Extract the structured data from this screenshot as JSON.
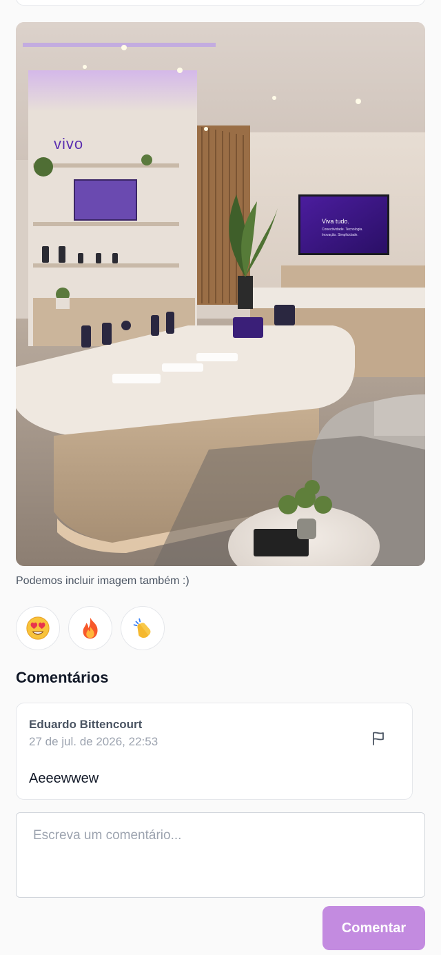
{
  "post": {
    "image_alt": "",
    "brand_logo_text": "vivo",
    "tv_screen": {
      "headline": "Viva tudo.",
      "subline_1": "Conectividade. Tecnologia.",
      "subline_2": "Inovação. Simplicidade."
    },
    "caption": "Podemos incluir imagem também :)"
  },
  "reactions": [
    {
      "icon": "heart-eyes-emoji-icon"
    },
    {
      "icon": "fire-emoji-icon"
    },
    {
      "icon": "clapping-hands-emoji-icon"
    }
  ],
  "comments": {
    "title": "Comentários",
    "items": [
      {
        "author": "Eduardo Bittencourt",
        "date": "27 de jul. de 2026, 22:53",
        "text": "Aeeewwew",
        "action_icon": "flag-icon"
      }
    ],
    "input_placeholder": "Escreva um comentário...",
    "submit_label": "Comentar"
  },
  "colors": {
    "accent": "#c38be0",
    "brand_purple": "#5b2fb0",
    "background": "#fafafa"
  }
}
